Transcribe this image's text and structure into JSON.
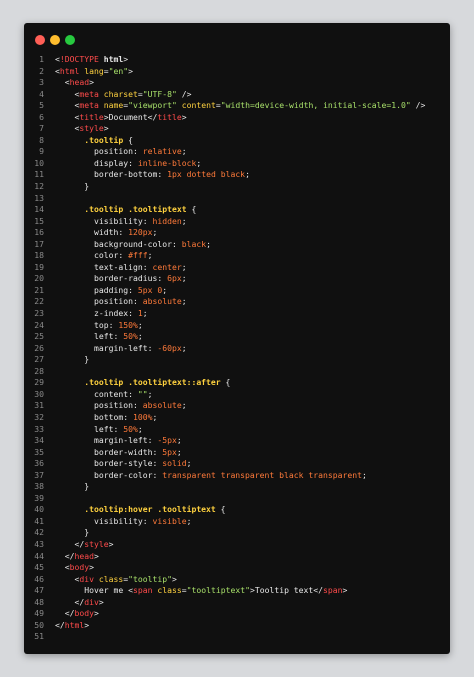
{
  "window": {
    "background": "#101010",
    "controls": [
      {
        "name": "close",
        "color": "#ff5f56"
      },
      {
        "name": "minimize",
        "color": "#ffbd2e"
      },
      {
        "name": "zoom",
        "color": "#27c93f"
      }
    ]
  },
  "colors": {
    "line_number": "#8a8a8a",
    "text": "#e8e8e8",
    "tag": "#ff4b4b",
    "attr": "#ffd23f",
    "string": "#a8e06a",
    "selector": "#ffd23f",
    "property": "#e8e8e8",
    "value": "#ff7a3a",
    "doctype": "#ff4b4b"
  },
  "code_lines": [
    {
      "n": "1",
      "tokens": [
        [
          "t",
          "<"
        ],
        [
          "doctype",
          "!DOCTYPE"
        ],
        [
          "t",
          " "
        ],
        [
          "b",
          "html"
        ],
        [
          "t",
          ">"
        ]
      ]
    },
    {
      "n": "2",
      "tokens": [
        [
          "t",
          "<"
        ],
        [
          "tag",
          "html"
        ],
        [
          "t",
          " "
        ],
        [
          "attr",
          "lang"
        ],
        [
          "t",
          "="
        ],
        [
          "string",
          "\"en\""
        ],
        [
          "t",
          ">"
        ]
      ]
    },
    {
      "n": "3",
      "tokens": [
        [
          "t",
          "  <"
        ],
        [
          "tag",
          "head"
        ],
        [
          "t",
          ">"
        ]
      ]
    },
    {
      "n": "4",
      "tokens": [
        [
          "t",
          "    <"
        ],
        [
          "tag",
          "meta"
        ],
        [
          "t",
          " "
        ],
        [
          "attr",
          "charset"
        ],
        [
          "t",
          "="
        ],
        [
          "string",
          "\"UTF-8\""
        ],
        [
          "t",
          " />"
        ]
      ]
    },
    {
      "n": "5",
      "tokens": [
        [
          "t",
          "    <"
        ],
        [
          "tag",
          "meta"
        ],
        [
          "t",
          " "
        ],
        [
          "attr",
          "name"
        ],
        [
          "t",
          "="
        ],
        [
          "string",
          "\"viewport\""
        ],
        [
          "t",
          " "
        ],
        [
          "attr",
          "content"
        ],
        [
          "t",
          "="
        ],
        [
          "string",
          "\"width=device-width, initial-scale=1.0\""
        ],
        [
          "t",
          " />"
        ]
      ]
    },
    {
      "n": "6",
      "tokens": [
        [
          "t",
          "    <"
        ],
        [
          "tag",
          "title"
        ],
        [
          "t",
          ">Document</"
        ],
        [
          "tag",
          "title"
        ],
        [
          "t",
          ">"
        ]
      ]
    },
    {
      "n": "7",
      "tokens": [
        [
          "t",
          "    <"
        ],
        [
          "tag",
          "style"
        ],
        [
          "t",
          ">"
        ]
      ]
    },
    {
      "n": "8",
      "tokens": [
        [
          "selector",
          "      .tooltip"
        ],
        [
          "t",
          " {"
        ]
      ]
    },
    {
      "n": "9",
      "tokens": [
        [
          "property",
          "        position"
        ],
        [
          "t",
          ": "
        ],
        [
          "value",
          "relative"
        ],
        [
          "t",
          ";"
        ]
      ]
    },
    {
      "n": "10",
      "tokens": [
        [
          "property",
          "        display"
        ],
        [
          "t",
          ": "
        ],
        [
          "value",
          "inline-block"
        ],
        [
          "t",
          ";"
        ]
      ]
    },
    {
      "n": "11",
      "tokens": [
        [
          "property",
          "        border-bottom"
        ],
        [
          "t",
          ": "
        ],
        [
          "value",
          "1px dotted black"
        ],
        [
          "t",
          ";"
        ]
      ]
    },
    {
      "n": "12",
      "tokens": [
        [
          "t",
          "      }"
        ]
      ]
    },
    {
      "n": "13",
      "tokens": [
        [
          "t",
          ""
        ]
      ]
    },
    {
      "n": "14",
      "tokens": [
        [
          "selector",
          "      .tooltip .tooltiptext"
        ],
        [
          "t",
          " {"
        ]
      ]
    },
    {
      "n": "15",
      "tokens": [
        [
          "property",
          "        visibility"
        ],
        [
          "t",
          ": "
        ],
        [
          "value",
          "hidden"
        ],
        [
          "t",
          ";"
        ]
      ]
    },
    {
      "n": "16",
      "tokens": [
        [
          "property",
          "        width"
        ],
        [
          "t",
          ": "
        ],
        [
          "value",
          "120px"
        ],
        [
          "t",
          ";"
        ]
      ]
    },
    {
      "n": "17",
      "tokens": [
        [
          "property",
          "        background-color"
        ],
        [
          "t",
          ": "
        ],
        [
          "value",
          "black"
        ],
        [
          "t",
          ";"
        ]
      ]
    },
    {
      "n": "18",
      "tokens": [
        [
          "property",
          "        color"
        ],
        [
          "t",
          ": "
        ],
        [
          "value",
          "#fff"
        ],
        [
          "t",
          ";"
        ]
      ]
    },
    {
      "n": "19",
      "tokens": [
        [
          "property",
          "        text-align"
        ],
        [
          "t",
          ": "
        ],
        [
          "value",
          "center"
        ],
        [
          "t",
          ";"
        ]
      ]
    },
    {
      "n": "20",
      "tokens": [
        [
          "property",
          "        border-radius"
        ],
        [
          "t",
          ": "
        ],
        [
          "value",
          "6px"
        ],
        [
          "t",
          ";"
        ]
      ]
    },
    {
      "n": "21",
      "tokens": [
        [
          "property",
          "        padding"
        ],
        [
          "t",
          ": "
        ],
        [
          "value",
          "5px 0"
        ],
        [
          "t",
          ";"
        ]
      ]
    },
    {
      "n": "22",
      "tokens": [
        [
          "property",
          "        position"
        ],
        [
          "t",
          ": "
        ],
        [
          "value",
          "absolute"
        ],
        [
          "t",
          ";"
        ]
      ]
    },
    {
      "n": "23",
      "tokens": [
        [
          "property",
          "        z-index"
        ],
        [
          "t",
          ": "
        ],
        [
          "value",
          "1"
        ],
        [
          "t",
          ";"
        ]
      ]
    },
    {
      "n": "24",
      "tokens": [
        [
          "property",
          "        top"
        ],
        [
          "t",
          ": "
        ],
        [
          "value",
          "150%"
        ],
        [
          "t",
          ";"
        ]
      ]
    },
    {
      "n": "25",
      "tokens": [
        [
          "property",
          "        left"
        ],
        [
          "t",
          ": "
        ],
        [
          "value",
          "50%"
        ],
        [
          "t",
          ";"
        ]
      ]
    },
    {
      "n": "26",
      "tokens": [
        [
          "property",
          "        margin-left"
        ],
        [
          "t",
          ": "
        ],
        [
          "value",
          "-60px"
        ],
        [
          "t",
          ";"
        ]
      ]
    },
    {
      "n": "27",
      "tokens": [
        [
          "t",
          "      }"
        ]
      ]
    },
    {
      "n": "28",
      "tokens": [
        [
          "t",
          ""
        ]
      ]
    },
    {
      "n": "29",
      "tokens": [
        [
          "selector",
          "      .tooltip .tooltiptext::after"
        ],
        [
          "t",
          " {"
        ]
      ]
    },
    {
      "n": "30",
      "tokens": [
        [
          "property",
          "        content"
        ],
        [
          "t",
          ": "
        ],
        [
          "string",
          "\"\""
        ],
        [
          "t",
          ";"
        ]
      ]
    },
    {
      "n": "31",
      "tokens": [
        [
          "property",
          "        position"
        ],
        [
          "t",
          ": "
        ],
        [
          "value",
          "absolute"
        ],
        [
          "t",
          ";"
        ]
      ]
    },
    {
      "n": "32",
      "tokens": [
        [
          "property",
          "        bottom"
        ],
        [
          "t",
          ": "
        ],
        [
          "value",
          "100%"
        ],
        [
          "t",
          ";"
        ]
      ]
    },
    {
      "n": "33",
      "tokens": [
        [
          "property",
          "        left"
        ],
        [
          "t",
          ": "
        ],
        [
          "value",
          "50%"
        ],
        [
          "t",
          ";"
        ]
      ]
    },
    {
      "n": "34",
      "tokens": [
        [
          "property",
          "        margin-left"
        ],
        [
          "t",
          ": "
        ],
        [
          "value",
          "-5px"
        ],
        [
          "t",
          ";"
        ]
      ]
    },
    {
      "n": "35",
      "tokens": [
        [
          "property",
          "        border-width"
        ],
        [
          "t",
          ": "
        ],
        [
          "value",
          "5px"
        ],
        [
          "t",
          ";"
        ]
      ]
    },
    {
      "n": "36",
      "tokens": [
        [
          "property",
          "        border-style"
        ],
        [
          "t",
          ": "
        ],
        [
          "value",
          "solid"
        ],
        [
          "t",
          ";"
        ]
      ]
    },
    {
      "n": "37",
      "tokens": [
        [
          "property",
          "        border-color"
        ],
        [
          "t",
          ": "
        ],
        [
          "value",
          "transparent transparent black transparent"
        ],
        [
          "t",
          ";"
        ]
      ]
    },
    {
      "n": "38",
      "tokens": [
        [
          "t",
          "      }"
        ]
      ]
    },
    {
      "n": "39",
      "tokens": [
        [
          "t",
          ""
        ]
      ]
    },
    {
      "n": "40",
      "tokens": [
        [
          "selector",
          "      .tooltip:hover .tooltiptext"
        ],
        [
          "t",
          " {"
        ]
      ]
    },
    {
      "n": "41",
      "tokens": [
        [
          "property",
          "        visibility"
        ],
        [
          "t",
          ": "
        ],
        [
          "value",
          "visible"
        ],
        [
          "t",
          ";"
        ]
      ]
    },
    {
      "n": "42",
      "tokens": [
        [
          "t",
          "      }"
        ]
      ]
    },
    {
      "n": "43",
      "tokens": [
        [
          "t",
          "    </"
        ],
        [
          "tag",
          "style"
        ],
        [
          "t",
          ">"
        ]
      ]
    },
    {
      "n": "44",
      "tokens": [
        [
          "t",
          "  </"
        ],
        [
          "tag",
          "head"
        ],
        [
          "t",
          ">"
        ]
      ]
    },
    {
      "n": "45",
      "tokens": [
        [
          "t",
          "  <"
        ],
        [
          "tag",
          "body"
        ],
        [
          "t",
          ">"
        ]
      ]
    },
    {
      "n": "46",
      "tokens": [
        [
          "t",
          "    <"
        ],
        [
          "tag",
          "div"
        ],
        [
          "t",
          " "
        ],
        [
          "attr",
          "class"
        ],
        [
          "t",
          "="
        ],
        [
          "string",
          "\"tooltip\""
        ],
        [
          "t",
          ">"
        ]
      ]
    },
    {
      "n": "47",
      "tokens": [
        [
          "t",
          "      Hover me <"
        ],
        [
          "tag",
          "span"
        ],
        [
          "t",
          " "
        ],
        [
          "attr",
          "class"
        ],
        [
          "t",
          "="
        ],
        [
          "string",
          "\"tooltiptext\""
        ],
        [
          "t",
          ">Tooltip text</"
        ],
        [
          "tag",
          "span"
        ],
        [
          "t",
          ">"
        ]
      ]
    },
    {
      "n": "48",
      "tokens": [
        [
          "t",
          "    </"
        ],
        [
          "tag",
          "div"
        ],
        [
          "t",
          ">"
        ]
      ]
    },
    {
      "n": "49",
      "tokens": [
        [
          "t",
          "  </"
        ],
        [
          "tag",
          "body"
        ],
        [
          "t",
          ">"
        ]
      ]
    },
    {
      "n": "50",
      "tokens": [
        [
          "t",
          "</"
        ],
        [
          "tag",
          "html"
        ],
        [
          "t",
          ">"
        ]
      ]
    },
    {
      "n": "51",
      "tokens": [
        [
          "t",
          ""
        ]
      ]
    }
  ]
}
